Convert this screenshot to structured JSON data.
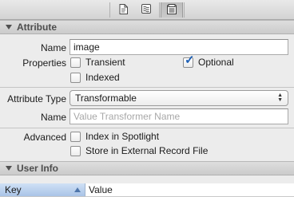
{
  "toolbar": {
    "buttons": [
      {
        "icon": "file-inspector-icon"
      },
      {
        "icon": "quick-help-icon"
      },
      {
        "icon": "data-model-inspector-icon"
      }
    ]
  },
  "attribute_section": {
    "title": "Attribute",
    "name_label": "Name",
    "name_value": "image",
    "properties_label": "Properties",
    "transient_label": "Transient",
    "transient_checked": false,
    "optional_label": "Optional",
    "optional_checked": true,
    "indexed_label": "Indexed",
    "indexed_checked": false,
    "attribute_type_label": "Attribute Type",
    "attribute_type_value": "Transformable",
    "transformer_name_label": "Name",
    "transformer_placeholder": "Value Transformer Name",
    "advanced_label": "Advanced",
    "spotlight_label": "Index in Spotlight",
    "spotlight_checked": false,
    "external_label": "Store in External Record File",
    "external_checked": false
  },
  "user_info_section": {
    "title": "User Info",
    "columns": [
      "Key",
      "Value"
    ]
  },
  "colors": {
    "accent": "#1d5fb5",
    "header_selected": "#a9c4e7"
  }
}
